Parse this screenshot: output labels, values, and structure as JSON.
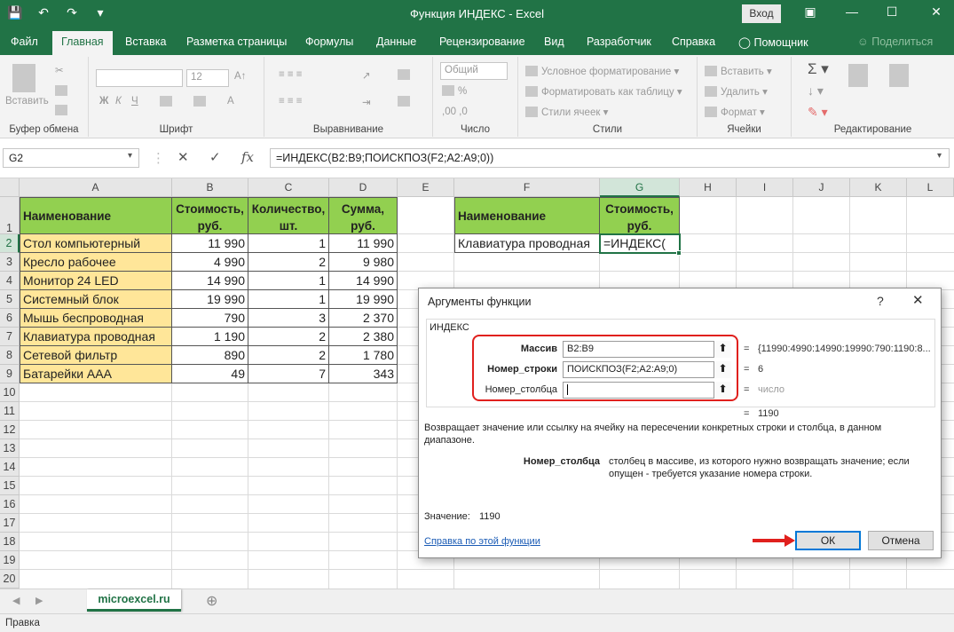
{
  "window": {
    "title": "Функция ИНДЕКС  -  Excel",
    "signin": "Вход",
    "qat_icons": [
      "save-icon",
      "undo-icon",
      "redo-icon",
      "customize-icon"
    ],
    "controls": [
      "ribbon-options-icon",
      "minimize-icon",
      "maximize-icon",
      "close-icon"
    ]
  },
  "tabs": [
    {
      "label": "Файл"
    },
    {
      "label": "Главная"
    },
    {
      "label": "Вставка"
    },
    {
      "label": "Разметка страницы"
    },
    {
      "label": "Формулы"
    },
    {
      "label": "Данные"
    },
    {
      "label": "Рецензирование"
    },
    {
      "label": "Вид"
    },
    {
      "label": "Разработчик"
    },
    {
      "label": "Справка"
    },
    {
      "label": "Помощник"
    },
    {
      "label": "Поделиться"
    }
  ],
  "ribbon": {
    "paste": "Вставить",
    "font_size": "12",
    "number_format": "Общий",
    "cond_format": "Условное форматирование",
    "format_table": "Форматировать как таблицу",
    "cell_styles": "Стили ячеек",
    "insert": "Вставить",
    "delete": "Удалить",
    "format": "Формат",
    "groups": [
      "Буфер обмена",
      "Шрифт",
      "Выравнивание",
      "Число",
      "Стили",
      "Ячейки",
      "Редактирование"
    ]
  },
  "formula_bar": {
    "name_box": "G2",
    "formula": "=ИНДЕКС(B2:B9;ПОИСКПОЗ(F2;A2:A9;0))",
    "fx": "fx"
  },
  "columns": [
    "A",
    "B",
    "C",
    "D",
    "E",
    "F",
    "G",
    "H",
    "I",
    "J",
    "K",
    "L"
  ],
  "rows": [
    "1",
    "2",
    "3",
    "4",
    "5",
    "6",
    "7",
    "8",
    "9",
    "10",
    "11",
    "12",
    "13",
    "14",
    "15",
    "16",
    "17",
    "18",
    "19",
    "20"
  ],
  "table": {
    "headers": [
      "Наименование",
      "Стоимость, руб.",
      "Количество, шт.",
      "Сумма, руб."
    ],
    "rows": [
      [
        "Стол компьютерный",
        "11 990",
        "1",
        "11 990"
      ],
      [
        "Кресло рабочее",
        "4 990",
        "2",
        "9 980"
      ],
      [
        "Монитор 24 LED",
        "14 990",
        "1",
        "14 990"
      ],
      [
        "Системный блок",
        "19 990",
        "1",
        "19 990"
      ],
      [
        "Мышь беспроводная",
        "790",
        "3",
        "2 370"
      ],
      [
        "Клавиатура проводная",
        "1 190",
        "2",
        "2 380"
      ],
      [
        "Сетевой фильтр",
        "890",
        "2",
        "1 780"
      ],
      [
        "Батарейки ААА",
        "49",
        "7",
        "343"
      ]
    ]
  },
  "lookup": {
    "header_name": "Наименование",
    "header_cost": "Стоимость, руб.",
    "name_value": "Клавиатура проводная",
    "formula_in_cell": "=ИНДЕКС("
  },
  "sheet": {
    "tab": "microexcel.ru",
    "status": "Правка"
  },
  "dialog": {
    "title": "Аргументы функции",
    "function_name": "ИНДЕКС",
    "args": [
      {
        "label": "Массив",
        "value": "B2:B9",
        "result": "{11990:4990:14990:19990:790:1190:8..."
      },
      {
        "label": "Номер_строки",
        "value": "ПОИСКПОЗ(F2;A2:A9;0)",
        "result": "6"
      },
      {
        "label": "Номер_столбца",
        "value": "",
        "result": "число"
      }
    ],
    "eq": "=",
    "result_total": "1190",
    "description": "Возвращает значение или ссылку на ячейку на пересечении конкретных строки и столбца, в данном диапазоне.",
    "param_name": "Номер_столбца",
    "param_desc": "столбец в массиве, из которого нужно возвращать значение; если опущен - требуется указание номера строки.",
    "value_label": "Значение:",
    "value": "1190",
    "help_link": "Справка по этой функции",
    "ok": "ОК",
    "cancel": "Отмена"
  },
  "colors": {
    "excel_green": "#217346",
    "header_fill": "#92d050",
    "name_fill": "#ffe699",
    "annotation_red": "#e0201d"
  }
}
